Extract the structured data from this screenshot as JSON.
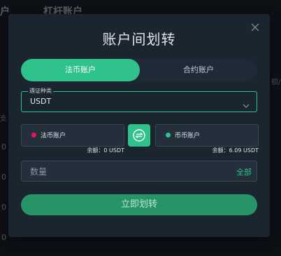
{
  "background": {
    "title_left": "户",
    "title": "杠杆账户",
    "right_fragment": "额/",
    "left_fragment": "支",
    "numbers": [
      "0",
      "0",
      "0",
      "0"
    ]
  },
  "modal": {
    "title": "账户间划转",
    "tabs": [
      {
        "label": "法币账户",
        "active": true
      },
      {
        "label": "合约账户",
        "active": false
      }
    ],
    "currency": {
      "legend": "遴证种类",
      "value": "USDT"
    },
    "from_account": {
      "label": "法币账户",
      "dot_color": "#e8174f",
      "balance": "余额：0 USDT"
    },
    "to_account": {
      "label": "币币账户",
      "dot_color": "#2fc28a",
      "balance": "余额：6.09 USDT"
    },
    "amount": {
      "placeholder": "数量",
      "all_label": "全部"
    },
    "submit_label": "立即划转"
  },
  "colors": {
    "accent": "#2fc28a",
    "submit": "#279468",
    "modal_bg": "#1b2530"
  },
  "icons": {
    "close": "close-icon",
    "swap": "swap-icon",
    "chevron": "chevron-down-icon"
  }
}
